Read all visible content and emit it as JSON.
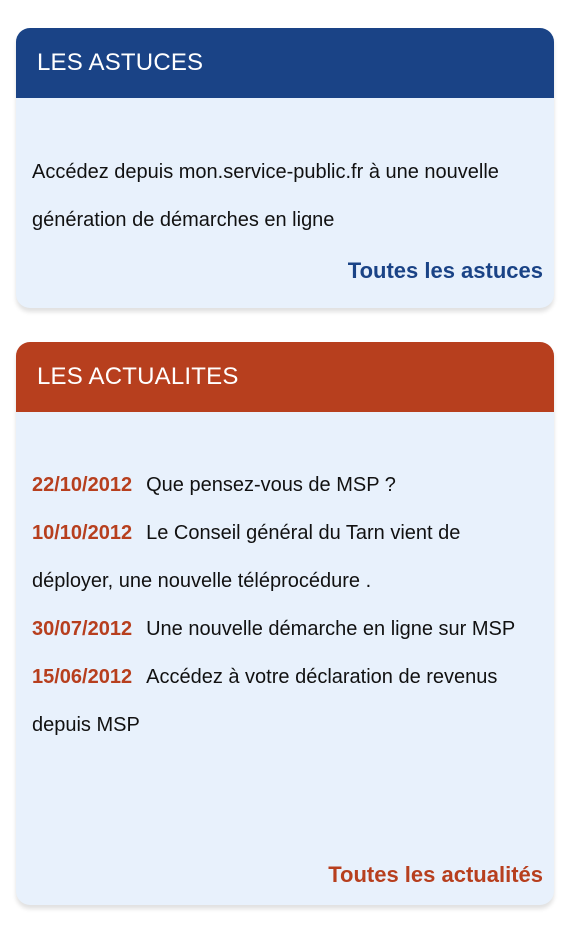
{
  "astuces": {
    "title": "LES ASTUCES",
    "text": "Accédez depuis mon.service-public.fr à une nouvelle génération de démarches en ligne",
    "link": "Toutes les astuces",
    "color": "#1a4386"
  },
  "actualites": {
    "title": "LES ACTUALITES",
    "items": [
      {
        "date": "22/10/2012",
        "text": "Que pensez-vous de MSP ?"
      },
      {
        "date": "10/10/2012",
        "text": "Le Conseil général du Tarn vient de déployer, une nouvelle téléprocédure ."
      },
      {
        "date": "30/07/2012",
        "text": "Une nouvelle démarche en ligne sur MSP"
      },
      {
        "date": "15/06/2012",
        "text": "Accédez à votre déclaration de revenus depuis MSP"
      }
    ],
    "link": "Toutes les actualités",
    "color": "#b73f1e"
  },
  "colors": {
    "card_background": "#e8f1fc"
  }
}
